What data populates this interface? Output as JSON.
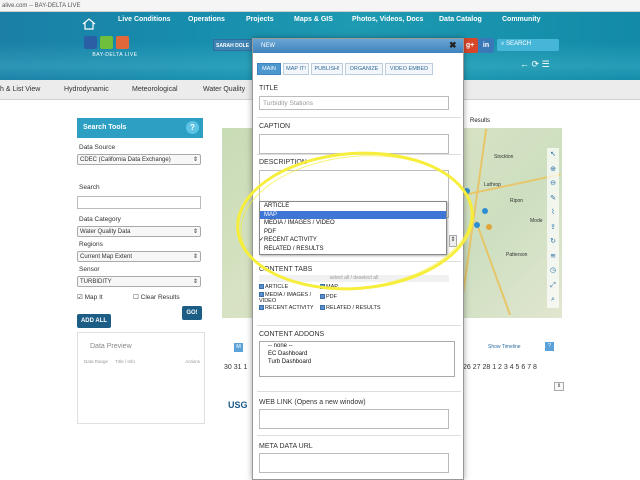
{
  "browser": {
    "url": "alive.com -- BAY-DELTA LIVE"
  },
  "topnav": {
    "items": [
      "Live Conditions",
      "Operations",
      "Projects",
      "Maps & GIS",
      "Photos, Videos, Docs",
      "Data Catalog",
      "Community"
    ]
  },
  "logo": {
    "text": "BAY-DELTA LIVE"
  },
  "header": {
    "user": "SARAH DOLE",
    "social": [
      "g+",
      "in"
    ],
    "search_label": "SEARCH"
  },
  "subnav": {
    "tabs": [
      "h & List View",
      "Hydrodynamic",
      "Meteorological",
      "Water Quality"
    ]
  },
  "search_tools": {
    "title": "Search Tools",
    "help": "?",
    "data_source_label": "Data Source",
    "data_source_value": "CDEC (California Data Exchange)",
    "search_label": "Search",
    "category_label": "Data Category",
    "category_value": "Water Quality Data",
    "regions_label": "Regions",
    "regions_value": "Current Map Extent",
    "sensor_label": "Sensor",
    "sensor_value": "TURBIDITY",
    "map_it": "Map It",
    "clear_results": "Clear Results",
    "go": "GO!",
    "add_all": "ADD ALL"
  },
  "preview": {
    "title": "Data Preview",
    "col1": "Data Range",
    "col2": "Title / Info",
    "col3": "Actions"
  },
  "map": {
    "results_label": "Results",
    "cities": [
      "Stockton",
      "Lathrop",
      "Ripon",
      "Mode",
      "Patterson"
    ],
    "badge": "M",
    "show_timeline": "Show Timeline",
    "timeline_help": "?"
  },
  "pagination": {
    "left": "30 31 1",
    "right": "26 27 28 1 2 3 4 5 6 7 8"
  },
  "usgs": "USG",
  "modal": {
    "header": "NEW",
    "close": "✖",
    "tabs": [
      "MAIN",
      "MAP IT!",
      "PUBLISH!",
      "ORGANIZE",
      "VIDEO EMBED"
    ],
    "title_label": "TITLE",
    "title_placeholder": "Turbidity Stations",
    "caption_label": "CAPTION",
    "description_label": "DESCRIPTION",
    "dropdown_options": [
      "ARTICLE",
      "MAP",
      "MEDIA / IMAGES / VIDEO",
      "PDF",
      "RECENT ACTIVITY",
      "RELATED / RESULTS"
    ],
    "dropdown_checked": "✓",
    "content_tabs_label": "CONTENT TABS",
    "select_all": "select all / deselect all",
    "content_tabs": [
      "ARTICLE",
      "MAP",
      "MEDIA / IMAGES / VIDEO",
      "PDF",
      "RECENT ACTIVITY",
      "RELATED / RESULTS"
    ],
    "addons_label": "CONTENT ADDONS",
    "addons": [
      "-- none --",
      "EC Dashboard",
      "Turb Dashboard"
    ],
    "weblink_label": "WEB LINK (Opens a new window)",
    "metadata_label": "META DATA URL"
  },
  "colors": {
    "accent": "#2c9fc3",
    "highlight": "#3f76d6",
    "annotation": "#f6ee3a",
    "dark_button": "#1b5d85"
  }
}
